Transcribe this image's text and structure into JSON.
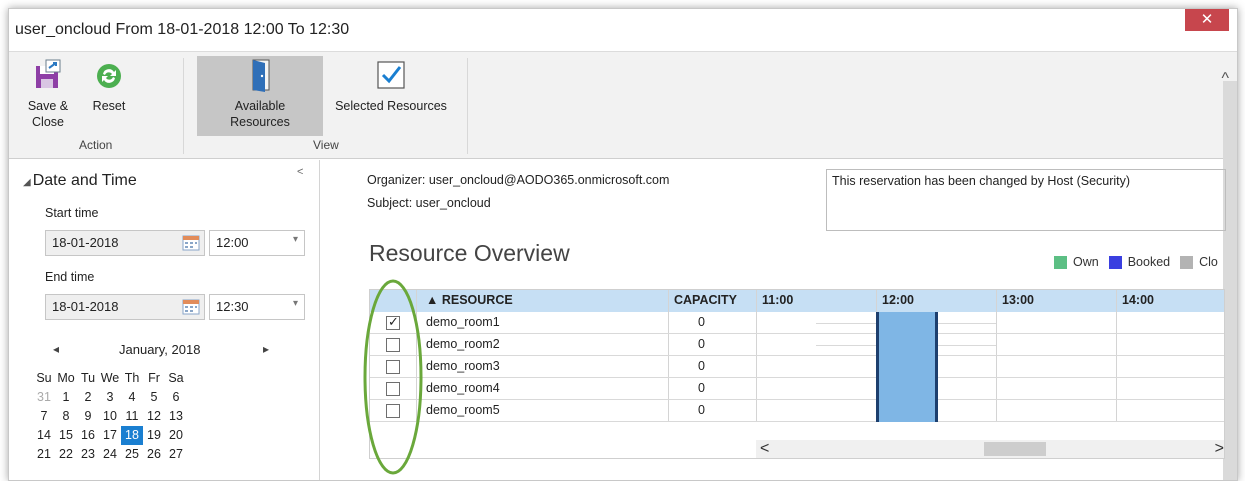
{
  "window": {
    "title": "user_oncloud From 18-01-2018 12:00 To 12:30",
    "close_label": "✕"
  },
  "ribbon": {
    "save_close_label": "Save & Close",
    "reset_label": "Reset",
    "available_resources_label": [
      "Available",
      "Resources"
    ],
    "selected_resources_label": "Selected Resources",
    "group_action": "Action",
    "group_view": "View",
    "collapse_label": "^"
  },
  "datetime": {
    "section_title": "Date and Time",
    "section_collapse": "<",
    "start_label": "Start time",
    "start_date": "18-01-2018",
    "start_time": "12:00",
    "end_label": "End time",
    "end_date": "18-01-2018",
    "end_time": "12:30"
  },
  "calendar": {
    "month_label": "January, 2018",
    "prev": "◂",
    "next": "▸",
    "weekdays": [
      "Su",
      "Mo",
      "Tu",
      "We",
      "Th",
      "Fr",
      "Sa"
    ],
    "weeks": [
      [
        "31",
        "1",
        "2",
        "3",
        "4",
        "5",
        "6"
      ],
      [
        "7",
        "8",
        "9",
        "10",
        "11",
        "12",
        "13"
      ],
      [
        "14",
        "15",
        "16",
        "17",
        "18",
        "19",
        "20"
      ],
      [
        "21",
        "22",
        "23",
        "24",
        "25",
        "26",
        "27"
      ]
    ],
    "muted_day": "31",
    "selected_day": "18"
  },
  "details": {
    "organizer": "Organizer: user_oncloud@AODO365.onmicrosoft.com",
    "subject": "Subject: user_oncloud",
    "notice": "This reservation has been changed by Host (Security)"
  },
  "overview": {
    "title": "Resource Overview",
    "legend": [
      {
        "label": "Own",
        "color": "#5cbf84"
      },
      {
        "label": "Booked",
        "color": "#3a3fe0"
      },
      {
        "label": "Clo",
        "color": "#b3b3b3"
      }
    ],
    "columns": {
      "resource": "▲ RESOURCE",
      "capacity": "CAPACITY",
      "times": [
        "11:00",
        "12:00",
        "13:00",
        "14:00"
      ]
    },
    "rows": [
      {
        "resource": "demo_room1",
        "capacity": "0",
        "checked": true
      },
      {
        "resource": "demo_room2",
        "capacity": "0",
        "checked": false
      },
      {
        "resource": "demo_room3",
        "capacity": "0",
        "checked": false
      },
      {
        "resource": "demo_room4",
        "capacity": "0",
        "checked": false
      },
      {
        "resource": "demo_room5",
        "capacity": "0",
        "checked": false
      }
    ],
    "booking_color": "#7fb6e5",
    "scroll_left": "<",
    "scroll_right": ">"
  }
}
